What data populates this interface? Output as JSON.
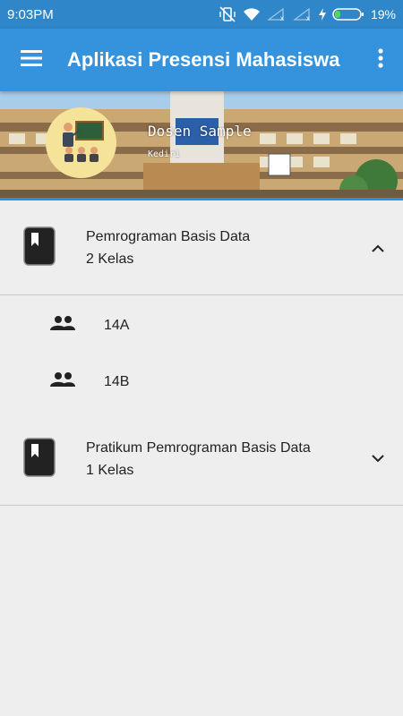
{
  "status": {
    "time": "9:03PM",
    "battery": "19%"
  },
  "appbar": {
    "title": "Aplikasi Presensi Mahasiswa"
  },
  "profile": {
    "name": "Dosen Sample",
    "city": "Kediri"
  },
  "courses": [
    {
      "name": "Pemrograman Basis Data",
      "count": "2 Kelas",
      "expanded": true,
      "classes": [
        {
          "name": "14A"
        },
        {
          "name": "14B"
        }
      ]
    },
    {
      "name": "Pratikum Pemrograman Basis Data",
      "count": "1 Kelas",
      "expanded": false
    }
  ],
  "colors": {
    "status_bar": "#2f86c8",
    "app_bar": "#3592dc",
    "avatar_bg": "#f6e39a",
    "background": "#eeeeee"
  }
}
